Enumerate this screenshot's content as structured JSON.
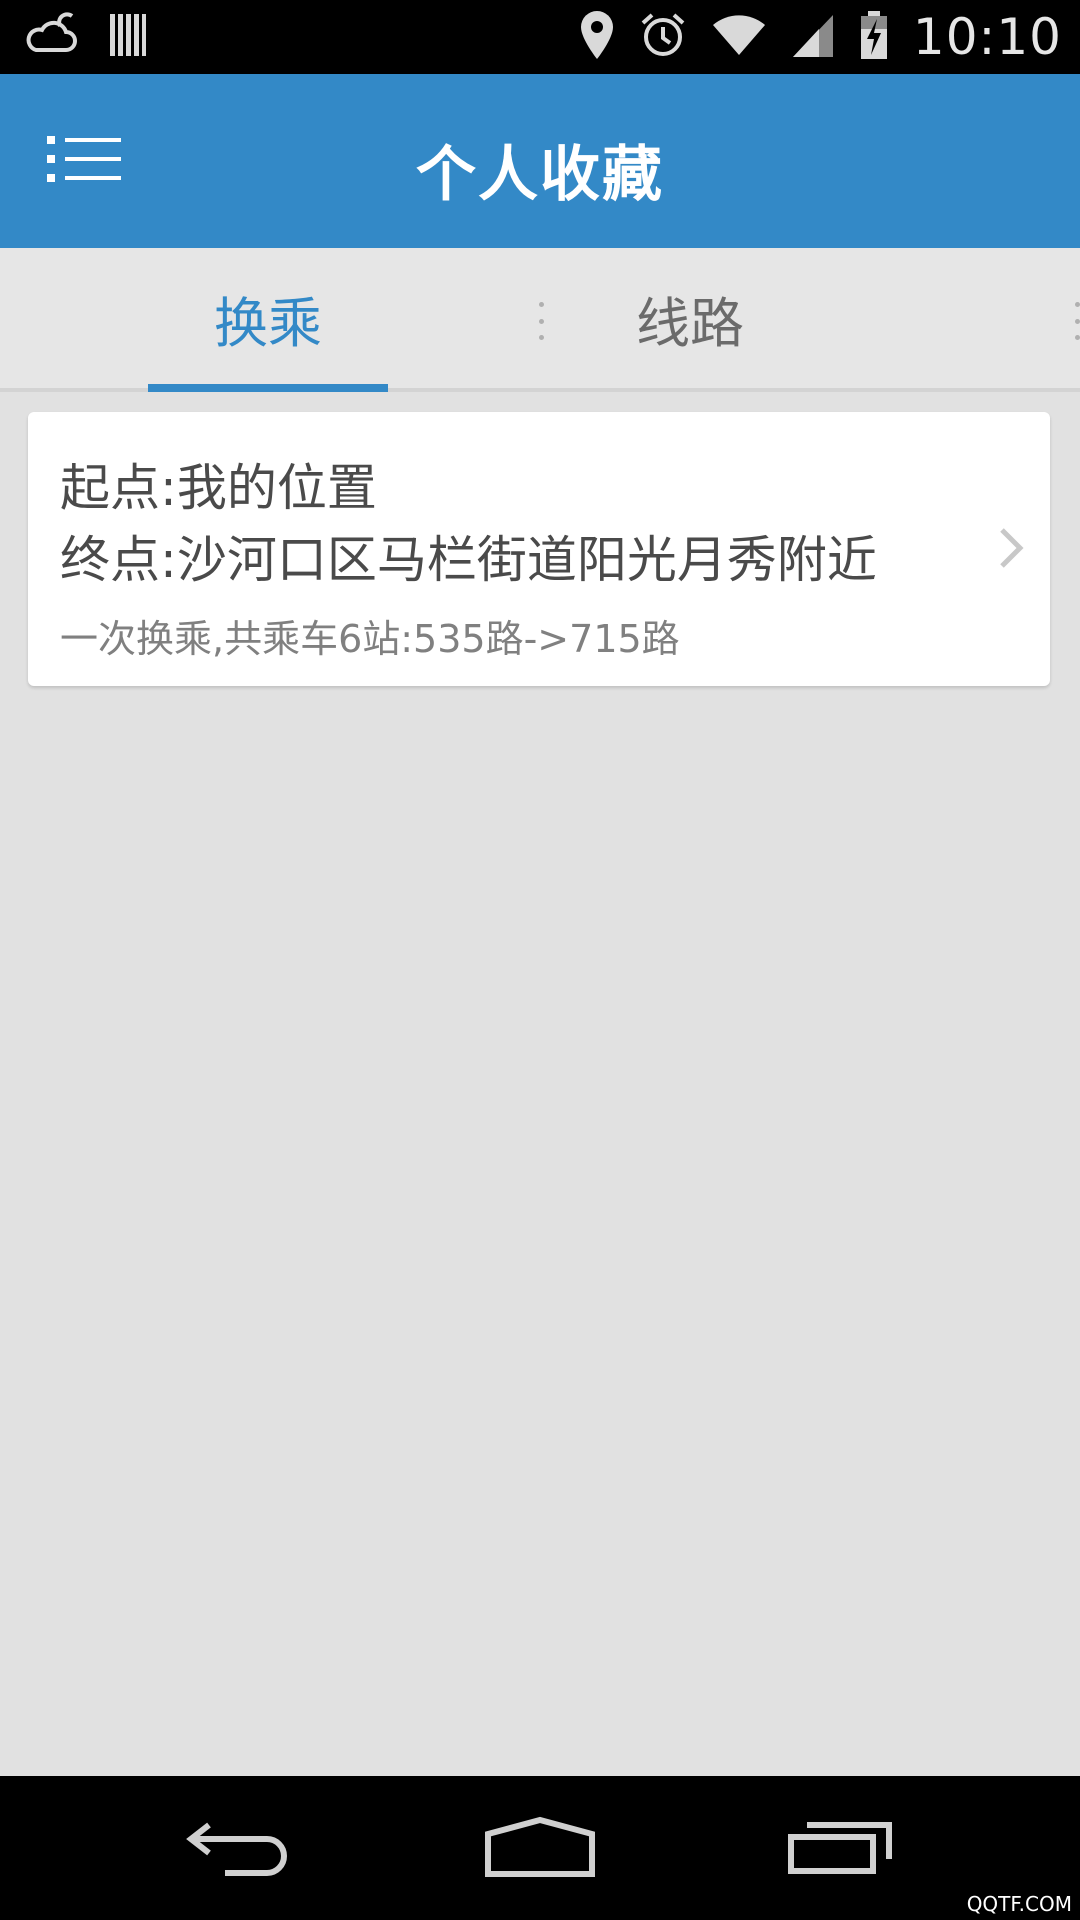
{
  "status_bar": {
    "time": "10:10",
    "icons": [
      "weather-cloud-icon",
      "barcode-icon",
      "location-pin-icon",
      "alarm-clock-icon",
      "wifi-icon",
      "signal-icon",
      "battery-charging-icon"
    ]
  },
  "app_bar": {
    "title": "个人收藏",
    "menu_icon": "menu-list-icon"
  },
  "tabs": [
    {
      "label": "换乘",
      "selected": true
    },
    {
      "label": "线路",
      "selected": false
    }
  ],
  "favorites": [
    {
      "start": "起点:我的位置",
      "end": "终点:沙河口区马栏街道阳光月秀附近",
      "summary": "一次换乘,共乘车6站:535路->715路"
    }
  ],
  "nav_bar": {
    "buttons": [
      "back-icon",
      "home-icon",
      "recent-apps-icon"
    ]
  },
  "watermark": "QQTF.COM",
  "colors": {
    "primary": "#3389c7",
    "background": "#e1e1e1",
    "card": "#ffffff",
    "status_bar": "#000000"
  }
}
